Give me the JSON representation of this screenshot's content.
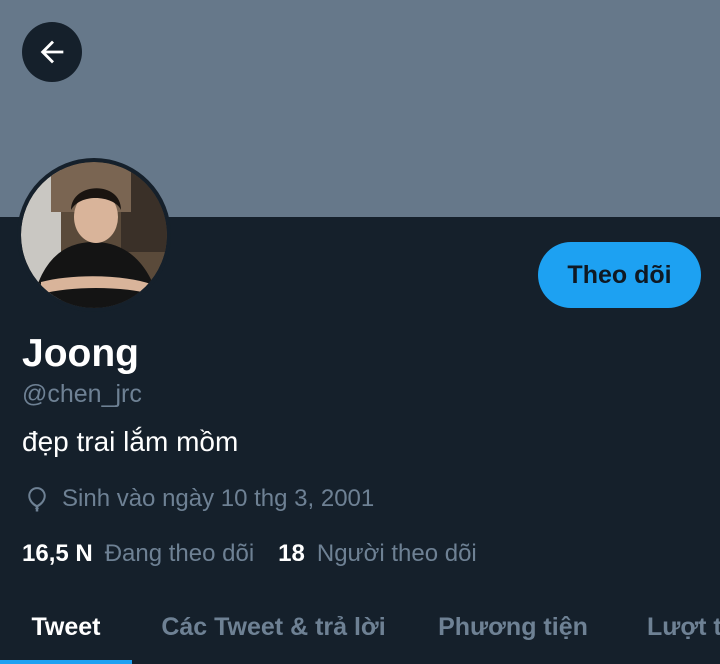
{
  "colors": {
    "background": "#15202b",
    "banner": "#66788a",
    "accent": "#1da1f2",
    "muted": "#6e8194"
  },
  "header": {
    "back_icon": "arrow-left-icon"
  },
  "profile": {
    "name": "Joong",
    "handle": "@chen_jrc",
    "bio": "đẹp trai lắm mồm",
    "birth_icon": "balloon-icon",
    "birthday": "Sinh vào ngày 10 thg 3, 2001",
    "following_count": "16,5 N",
    "following_label": "Đang theo dõi",
    "followers_count": "18",
    "followers_label": "Người theo dõi"
  },
  "actions": {
    "follow_label": "Theo dõi"
  },
  "tabs": [
    {
      "label": "Tweet",
      "active": true
    },
    {
      "label": "Các Tweet & trả lời",
      "active": false
    },
    {
      "label": "Phương tiện",
      "active": false
    },
    {
      "label": "Lượt thích",
      "active": false
    }
  ]
}
